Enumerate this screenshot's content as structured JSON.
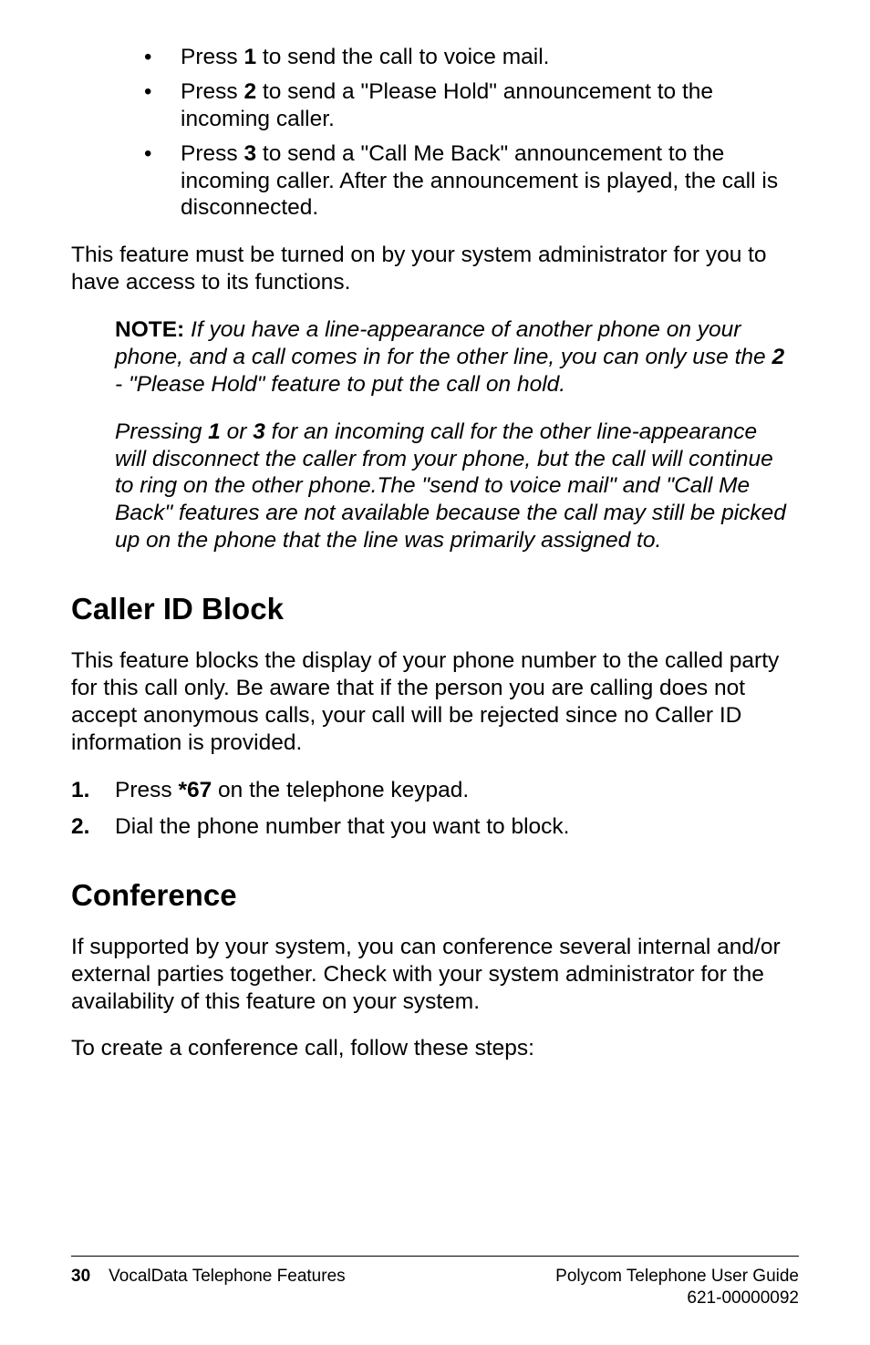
{
  "bullets": [
    {
      "prefix": "Press ",
      "key": "1",
      "suffix": " to send the call to voice mail."
    },
    {
      "prefix": "Press ",
      "key": "2",
      "suffix": " to send a \"Please Hold\" announcement to the incoming caller."
    },
    {
      "prefix": "Press ",
      "key": "3",
      "suffix": " to send a \"Call Me Back\" announcement to the incoming caller. After the announcement is played, the call is disconnected."
    }
  ],
  "para_feature": "This feature must be turned on by your system administrator for you to have access to its functions.",
  "note": {
    "label": "NOTE:",
    "p1_a": " If you have a line-appearance of another phone on your phone, and a call comes in for the other line, you can only use the ",
    "p1_key": "2",
    "p1_b": " - \"Please Hold\" feature to put the call on hold.",
    "p2_a": "Pressing ",
    "p2_key1": "1",
    "p2_mid": " or ",
    "p2_key2": "3",
    "p2_b": " for an incoming call for the other line-appearance will disconnect the caller from your phone, but the call will continue to ring on the other phone.The \"send to voice mail\" and \"Call Me Back\" features are not available because the call may still be picked up on the phone that the line was primarily assigned to."
  },
  "sections": {
    "caller_id": {
      "heading": "Caller ID Block",
      "para": "This feature blocks the display of your phone number to the called party for this call only. Be aware that if the person you are calling does not accept anonymous calls, your call will be rejected since no Caller ID information is provided.",
      "steps": [
        {
          "num": "1.",
          "prefix": "Press ",
          "code": "*67",
          "suffix": " on the telephone keypad."
        },
        {
          "num": "2.",
          "prefix": "Dial the phone number that you want to block.",
          "code": "",
          "suffix": ""
        }
      ]
    },
    "conference": {
      "heading": "Conference",
      "para1": "If supported by your system, you can conference several internal and/or external parties together. Check with your system administrator for the availability of this feature on your system.",
      "para2": "To create a conference call, follow these steps:"
    }
  },
  "footer": {
    "page": "30",
    "left_text": "VocalData Telephone Features",
    "right_line1": "Polycom Telephone User Guide",
    "right_line2": "621-00000092"
  }
}
